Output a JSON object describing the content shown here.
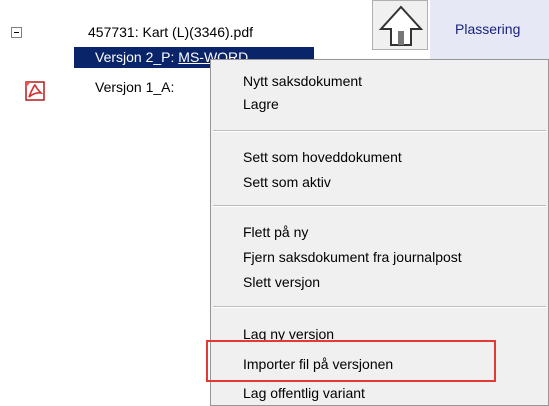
{
  "tree": {
    "file_label": "457731: Kart (L)(3346).pdf",
    "version2_prefix": "Versjon 2_P: ",
    "version2_suffix": "MS-WORD",
    "version1_label": "Versjon 1_A:"
  },
  "right_pane": {
    "plassering_label": "Plassering"
  },
  "context_menu": {
    "items": [
      "Nytt saksdokument",
      "Lagre",
      "Sett som hoveddokument",
      "Sett som aktiv",
      "Flett på ny",
      "Fjern saksdokument fra journalpost",
      "Slett versjon",
      "Lag ny versjon",
      "Importer fil på versjonen",
      "Lag offentlig variant"
    ]
  },
  "colors": {
    "selection": "#0a246a",
    "highlight_border": "#e53935"
  }
}
